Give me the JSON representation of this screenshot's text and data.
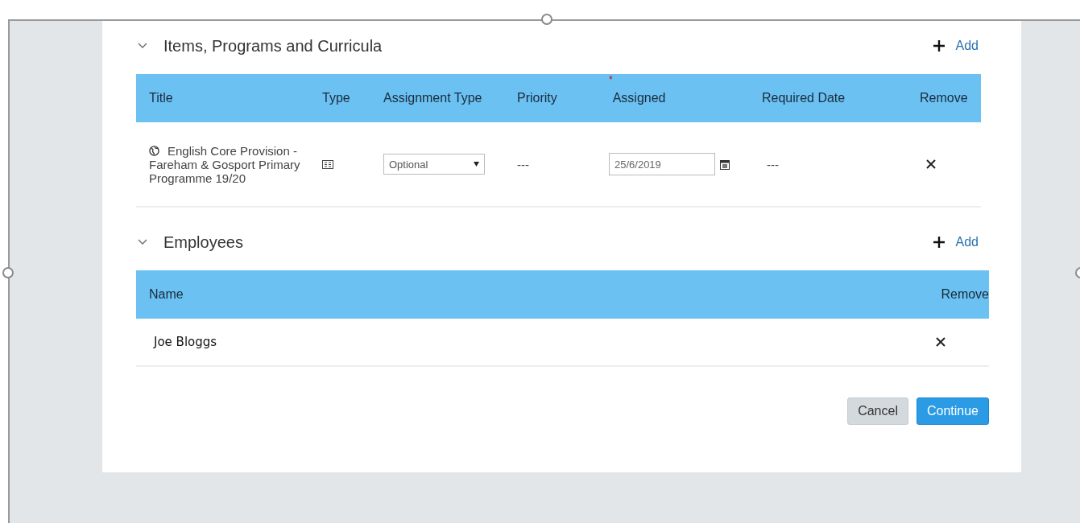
{
  "items_section": {
    "title": "Items, Programs and Curricula",
    "expanded": true,
    "add_label": "Add",
    "columns": [
      {
        "label": "Title"
      },
      {
        "label": "Type"
      },
      {
        "label": "Assignment Type"
      },
      {
        "label": "Priority"
      },
      {
        "label": "Assigned",
        "required_mark": "*"
      },
      {
        "label": "Required Date"
      },
      {
        "label": "Remove"
      }
    ],
    "rows": [
      {
        "title": "English Core Provision - Fareham & Gosport Primary Programme 19/20",
        "assignment_type": "Optional",
        "priority": "---",
        "assigned": "25/6/2019",
        "required_date": "---"
      }
    ]
  },
  "employees_section": {
    "title": "Employees",
    "expanded": true,
    "add_label": "Add",
    "columns": [
      {
        "label": "Name"
      },
      {
        "label": "Remove"
      }
    ],
    "rows": [
      {
        "name": "Joe Bloggs"
      }
    ]
  },
  "buttons": [
    {
      "label": "Cancel",
      "kind": "secondary"
    },
    {
      "label": "Continue",
      "kind": "primary"
    }
  ]
}
